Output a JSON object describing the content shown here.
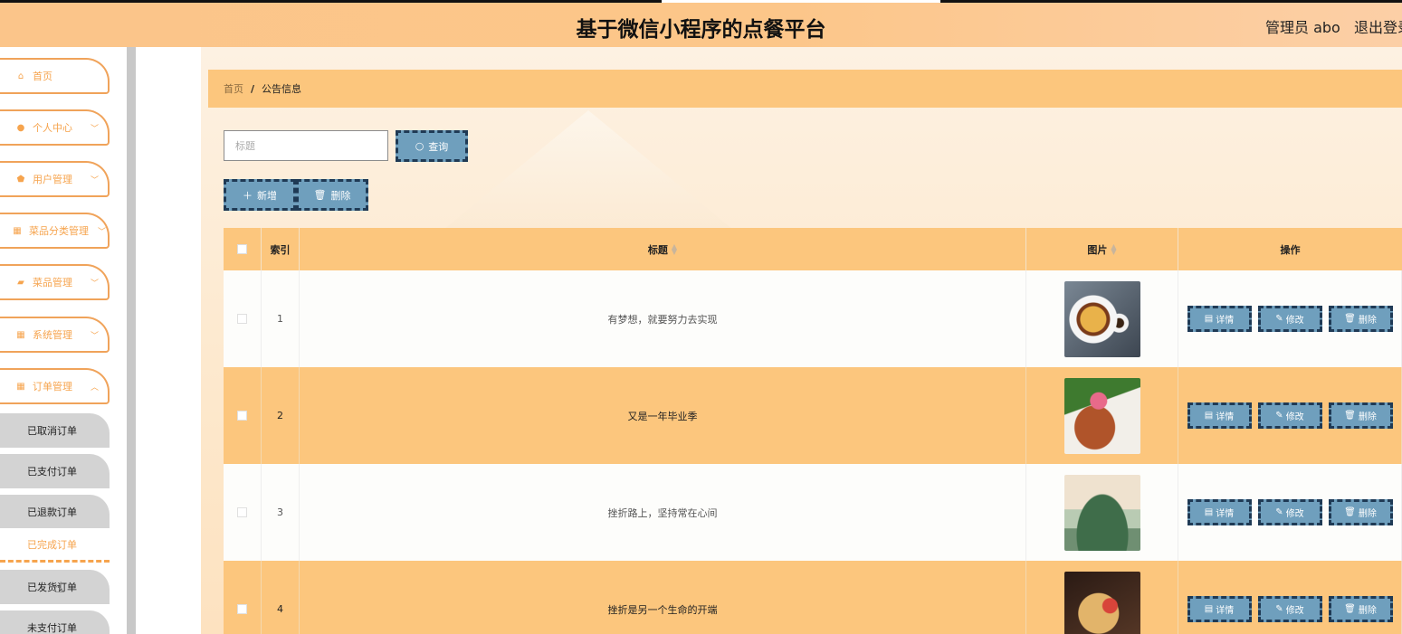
{
  "header": {
    "title": "基于微信小程序的点餐平台",
    "admin": "管理员 abo",
    "logout": "退出登录"
  },
  "sidebar": {
    "items": [
      {
        "label": "首页",
        "icon": "home-icon"
      },
      {
        "label": "个人中心",
        "icon": "user-icon"
      },
      {
        "label": "用户管理",
        "icon": "shield-icon"
      },
      {
        "label": "菜品分类管理",
        "icon": "grid-icon"
      },
      {
        "label": "菜品管理",
        "icon": "thumb-icon"
      },
      {
        "label": "系统管理",
        "icon": "grid-icon"
      },
      {
        "label": "订单管理",
        "icon": "grid-icon"
      }
    ],
    "sub_items": [
      "已取消订单",
      "已支付订单",
      "已退款订单",
      "已完成订单",
      "已发货订单",
      "未支付订单"
    ]
  },
  "breadcrumb": {
    "home": "首页",
    "separator": "/",
    "current": "公告信息"
  },
  "search": {
    "placeholder": "标题",
    "button": "查询"
  },
  "toolbar": {
    "add_label": "新增",
    "delete_label": "删除"
  },
  "table": {
    "headers": {
      "index": "索引",
      "title": "标题",
      "image": "图片",
      "actions": "操作"
    },
    "rows": [
      {
        "index": "1",
        "title": "有梦想，就要努力去实现"
      },
      {
        "index": "2",
        "title": "又是一年毕业季"
      },
      {
        "index": "3",
        "title": "挫折路上，坚持常在心间"
      },
      {
        "index": "4",
        "title": "挫折是另一个生命的开端"
      }
    ],
    "row_actions": {
      "detail": "详情",
      "edit": "修改",
      "delete": "删除"
    }
  },
  "colors": {
    "accent": "#fcc67d",
    "button": "#6f9fbd",
    "button_border": "#1f3a55",
    "nav_text": "#f6a44e"
  }
}
